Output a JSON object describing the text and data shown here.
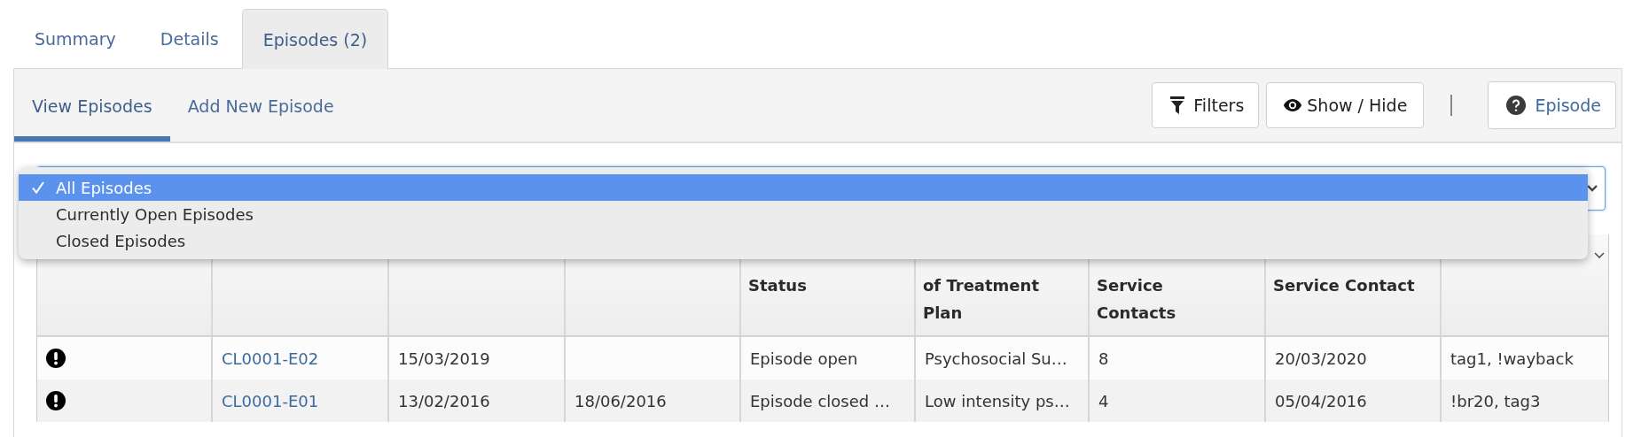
{
  "tabs": [
    {
      "label": "Summary",
      "selected": false
    },
    {
      "label": "Details",
      "selected": false
    },
    {
      "label": "Episodes (2)",
      "selected": true
    }
  ],
  "subtabs": [
    {
      "label": "View Episodes",
      "selected": true
    },
    {
      "label": "Add New Episode",
      "selected": false
    }
  ],
  "toolbar": {
    "buttons": [
      {
        "kind": "filter",
        "label": "Filters"
      },
      {
        "kind": "eye",
        "label": "Show / Hide"
      },
      {
        "kind": "help",
        "label": "Episode"
      }
    ]
  },
  "episode_filter": {
    "expanded": true,
    "options": [
      {
        "label": "All Episodes",
        "selected": true
      },
      {
        "label": "Currently Open Episodes",
        "selected": false
      },
      {
        "label": "Closed Episodes",
        "selected": false
      }
    ]
  },
  "table": {
    "columns": [
      null,
      null,
      null,
      "Status",
      "of Treatment Plan",
      "Service Contacts",
      "Service Contact",
      null
    ],
    "rows": [
      {
        "alert": true,
        "cells": [
          "CL0001-E02",
          "15/03/2019",
          null,
          "Episode open",
          "Psychosocial Su…",
          "8",
          "20/03/2020",
          "tag1, !wayback"
        ]
      },
      {
        "alert": true,
        "cells": [
          "CL0001-E01",
          "13/02/2016",
          "18/06/2016",
          "Episode closed …",
          "Low intensity ps…",
          "4",
          "05/04/2016",
          "!br20, tag3"
        ]
      }
    ]
  }
}
